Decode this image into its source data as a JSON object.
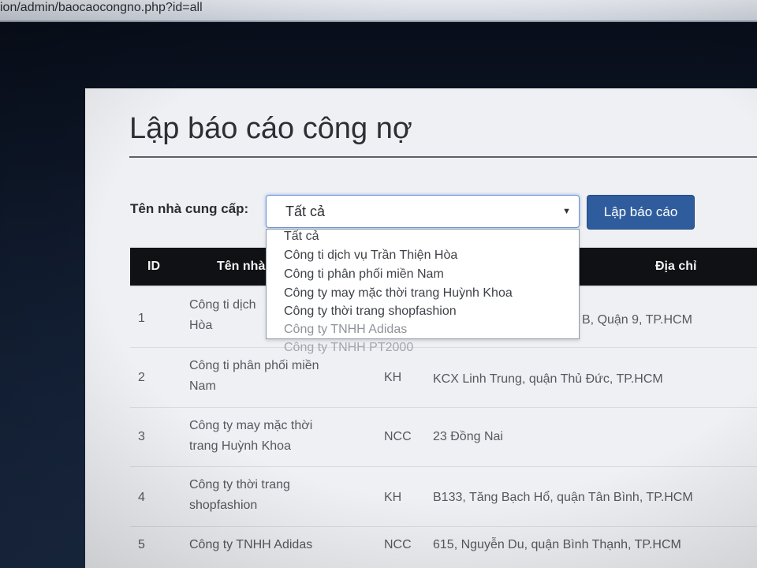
{
  "browser": {
    "url": "ion/admin/baocaocongno.php?id=all"
  },
  "page": {
    "title": "Lập báo cáo công nợ"
  },
  "form": {
    "supplier_label": "Tên nhà cung cấp:",
    "selected_value": "Tất cả",
    "caret": "▼",
    "submit_label": "Lập báo cáo"
  },
  "dropdown": {
    "options": [
      "Tất cả",
      "Công ti dịch vụ Trần Thiện Hòa",
      "Công ti phân phối miền Nam",
      "Công ty may mặc thời trang Huỳnh Khoa",
      "Công ty thời trang shopfashion",
      "Công ty TNHH Adidas",
      "Công ty TNHH PT2000"
    ]
  },
  "table": {
    "headers": {
      "id": "ID",
      "name": "Tên nhà",
      "address": "Địa chỉ"
    },
    "rows": [
      {
        "id": "1",
        "name_line1": "Công ti dịch",
        "name_line2": "Hòa",
        "type": "",
        "address": "B, Quận 9, TP.HCM"
      },
      {
        "id": "2",
        "name_line1": "Công ti phân phối miền",
        "name_line2": "Nam",
        "type": "KH",
        "address": "KCX Linh Trung, quận Thủ Đức, TP.HCM"
      },
      {
        "id": "3",
        "name_line1": "Công ty may mặc thời",
        "name_line2": "trang Huỳnh Khoa",
        "type": "NCC",
        "address": "23 Đồng Nai"
      },
      {
        "id": "4",
        "name_line1": "Công ty thời trang",
        "name_line2": "shopfashion",
        "type": "KH",
        "address": "B133, Tăng Bạch Hổ, quận Tân Bình, TP.HCM"
      },
      {
        "id": "5",
        "name_line1": "Công ty TNHH Adidas",
        "name_line2": "",
        "type": "NCC",
        "address": "615, Nguyễn Du, quận Bình Thạnh, TP.HCM"
      }
    ]
  }
}
